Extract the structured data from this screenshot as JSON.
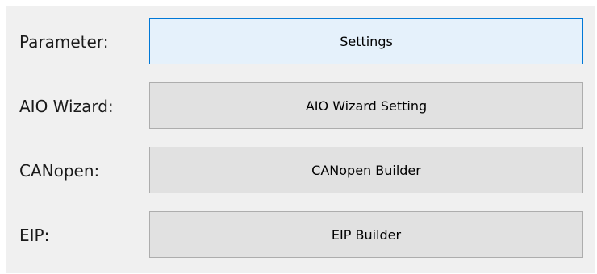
{
  "rows": [
    {
      "label": "Parameter:",
      "button": "Settings",
      "state": "focused"
    },
    {
      "label": "AIO Wizard:",
      "button": "AIO Wizard Setting",
      "state": "normal"
    },
    {
      "label": "CANopen:",
      "button": "CANopen Builder",
      "state": "normal"
    },
    {
      "label": "EIP:",
      "button": "EIP Builder",
      "state": "normal"
    }
  ],
  "colors": {
    "panel_background": "#f0f0f0",
    "button_background": "#e1e1e1",
    "button_border": "#adadad",
    "focused_border": "#0078d7",
    "focused_background": "#e5f1fb"
  }
}
